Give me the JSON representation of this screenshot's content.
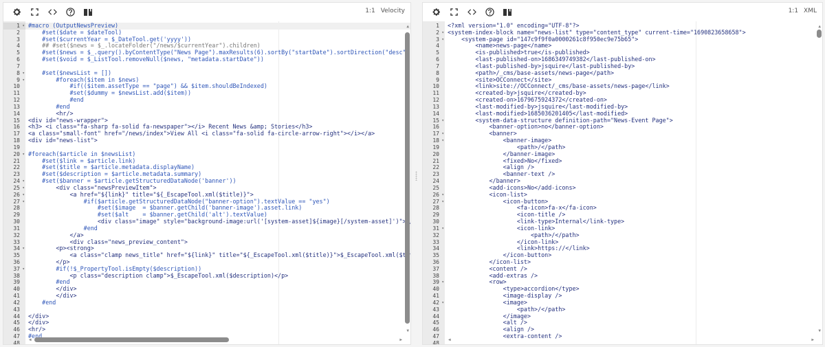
{
  "left_editor": {
    "toolbar": {
      "settings": "gear-icon",
      "fullscreen": "expand-icon",
      "format": "code-icon",
      "help": "help-icon",
      "docs": "book-icon"
    },
    "cursor_position": "1:1",
    "language": "Velocity",
    "active_line": 1,
    "fold_lines": [
      1,
      8,
      9,
      20,
      24,
      25,
      26,
      27,
      34,
      37
    ],
    "lines": [
      "#macro (OutputNewsPreview)",
      "    #set($date = $dateTool)",
      "    #set($currentYear = $_DateTool.get('yyyy'))",
      "    ## #set($news = $_.locateFolder(\"/news/$currentYear\").children)",
      "    #set($news = $_.query().byContentType(\"News Page\").maxResults(6).sortBy(\"startDate\").sortDirection(\"desc\").execute())",
      "    #set($void = $_ListTool.removeNull($news, \"metadata.startDate\"))",
      "",
      "    #set($newsList = [])",
      "        #foreach($item in $news)",
      "            #if(($item.assetType == \"page\") && $item.shouldBeIndexed)",
      "            #set($dummy = $newsList.add($item))",
      "            #end",
      "        #end",
      "        <hr/>",
      "<div id=\"news-wrapper\">",
      "<h3> <i class=\"fa-sharp fa-solid fa-newspaper\"></i> Recent News &amp; Stories</h3>",
      "<a class=\"small-font\" href=\"/news/index\">View All <i class=\"fa-solid fa-circle-arrow-right\"></i></a>",
      "<div id=\"news-list\">",
      "",
      "#foreach($article in $newsList)",
      "    #set($link = $article.link)",
      "    #set($title = $article.metadata.displayName)",
      "    #set($description = $article.metadata.summary)",
      "    #set($banner = $article.getStructuredDataNode('banner'))",
      "        <div class=\"newsPreviewItem\">",
      "            <a href=\"${link}\" title=\"${_EscapeTool.xml($title)}\">",
      "                #if($article.getStructuredDataNode(\"banner-option\").textValue == \"yes\")",
      "                    #set($image  = $banner.getChild('banner-image').asset.link)",
      "                    #set($alt    = $banner.getChild('alt').textValue)",
      "                    <div class=\"image\" style=\"background-image:url('[system-asset]${image}[/system-asset]')\"></div>",
      "                #end",
      "            </a>",
      "            <div class=\"news_preview_content\">",
      "        <p><strong>",
      "            <a class=\"clamp news_title\" href=\"${link}\" title=\"${_EscapeTool.xml($title)}\">$_EscapeTool.xml($title)</a></st",
      "        </p>",
      "        #if(!$_PropertyTool.isEmpty($description))",
      "            <p class=\"description clamp\">$_EscapeTool.xml($description)</p>",
      "        #end",
      "        </div>",
      "        </div>",
      "    #end",
      "",
      "</div>",
      "</div>",
      "<hr/>",
      "#end",
      ""
    ]
  },
  "right_editor": {
    "toolbar": {
      "settings": "gear-icon",
      "fullscreen": "expand-icon",
      "format": "code-icon",
      "help": "help-icon",
      "docs": "book-icon"
    },
    "cursor_position": "1:1",
    "language": "XML",
    "fold_lines": [
      2,
      3,
      15,
      17,
      18,
      26,
      27,
      31,
      39,
      42
    ],
    "lines": [
      "<?xml version=\"1.0\" encoding=\"UTF-8\"?>",
      "<system-index-block name=\"news-list\" type=\"content_type\" current-time=\"1690823658658\">",
      "    <system-page id=\"147c9f9f0a0000261c8f950ec9e75b65\">",
      "        <name>news-page</name>",
      "        <is-published>true</is-published>",
      "        <last-published-on>1686349749382</last-published-on>",
      "        <last-published-by>jsquire</last-published-by>",
      "        <path>/_cms/base-assets/news-page</path>",
      "        <site>OCConnect</site>",
      "        <link>site://OCConnect/_cms/base-assets/news-page</link>",
      "        <created-by>jsquire</created-by>",
      "        <created-on>1679675924372</created-on>",
      "        <last-modified-by>jsquire</last-modified-by>",
      "        <last-modified>1685036201405</last-modified>",
      "        <system-data-structure definition-path=\"News-Event Page\">",
      "            <banner-option>no</banner-option>",
      "            <banner>",
      "                <banner-image>",
      "                    <path>/</path>",
      "                </banner-image>",
      "                <fixed>No</fixed>",
      "                <align />",
      "                <banner-text />",
      "            </banner>",
      "            <add-icons>No</add-icons>",
      "            <icon-list>",
      "                <icon-button>",
      "                    <fa-icon>fa-x</fa-icon>",
      "                    <icon-title />",
      "                    <link-type>Internal</link-type>",
      "                    <icon-link>",
      "                        <path>/</path>",
      "                    </icon-link>",
      "                    <link>https://</link>",
      "                </icon-button>",
      "            </icon-list>",
      "            <content />",
      "            <add-extras />",
      "            <row>",
      "                <type>accordion</type>",
      "                <image-display />",
      "                <image>",
      "                    <path>/</path>",
      "                </image>",
      "                <alt />",
      "                <align />",
      "                <extra-content />",
      ""
    ]
  }
}
